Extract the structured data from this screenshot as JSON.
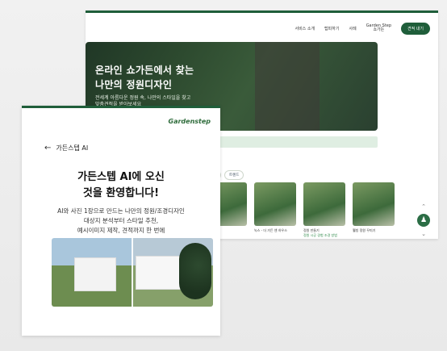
{
  "website": {
    "nav_items": [
      "서비스 소개",
      "탑피하기",
      "사례"
    ],
    "badge_top": "Garden Step",
    "badge_bottom": "쇼가든",
    "cta_label": "견적 내기",
    "hero_title_line1": "온라인 쇼가든에서 찾는",
    "hero_title_line2": "나만의 정원디자인",
    "hero_sub_line1": "전세계 아름다운 정원 속, 나만의 스타일을 찾고",
    "hero_sub_line2": "맞춤견적을 받아보세요",
    "chips": [
      "",
      "트렌드"
    ],
    "cards": [
      {
        "cap": "",
        "cap2": ""
      },
      {
        "cap": "녹스 - 더 가든 앤 하우스",
        "cap2": ""
      },
      {
        "cap": "정원 만들기",
        "cap2": "정원 시공 경험 조경 방법"
      },
      {
        "cap": "웰빙 정원 꾸미기",
        "cap2": ""
      }
    ]
  },
  "app": {
    "brand": "Gardenstep",
    "back_label": "가든스텝 AI",
    "welcome_line1": "가든스텝 AI에 오신",
    "welcome_line2": "것을 환영합니다!",
    "desc_line1": "AI와 사진 1장으로 만드는 나만의 정원/조경디자인",
    "desc_line2": "대상지 분석부터 스타일 추천,",
    "desc_line3": "예시이미지 제작, 견적까지 한 번에"
  },
  "icons": {
    "back": "arrow-left-icon",
    "chevron_up": "chevron-up-icon",
    "chevron_down": "chevron-down-icon",
    "chat": "chat-icon"
  },
  "colors": {
    "brand_green": "#1f5e3a",
    "accent_green": "#2d6b3a"
  }
}
